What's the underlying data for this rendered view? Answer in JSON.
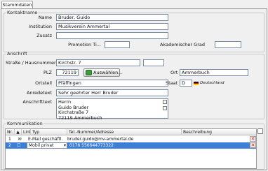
{
  "tab": "Stammdaten",
  "kontakt": {
    "legend": "Kontaktname",
    "name_label": "Name",
    "name_value": "Bruder, Guido",
    "institution_label": "Institution",
    "institution_value": "Musikverein Ammertal",
    "zusatz_label": "Zusatz",
    "zusatz_value": "",
    "promotion_label": "Promotion Ti...",
    "promotion_value": "",
    "akad_label": "Akademischer Grad",
    "akad_value": ""
  },
  "anschrift": {
    "legend": "Anschrift",
    "strasse_label": "Straße / Hausnummer",
    "strasse_value": "Kirchstr. 7",
    "hausnr_value": "",
    "plz_label": "PLZ",
    "plz_value": "72119",
    "auswaehlen_label": "Auswählen...",
    "ort_label": "Ort",
    "ort_value": "Ammerbuch",
    "ortsteil_label": "Ortsteil",
    "ortsteil_value": "Pfäffingen",
    "staat_label": "Staat",
    "staat_value": "D",
    "staat_name": "Deutschland",
    "anrede_label": "Anredetext",
    "anrede_value": "Sehr geehrter Herr Bruder",
    "anschrift_label": "Anschrifttext",
    "anschrift_lines": [
      "Herrn",
      "Guido Bruder",
      "Kirchstraße 7",
      "72119 Ammerbuch"
    ]
  },
  "kommunikation": {
    "legend": "Kommunikation",
    "columns": [
      "Nr.",
      "Link",
      "Typ",
      "Tel.-Nummer/Adresse",
      "Beschreibung"
    ],
    "rows": [
      {
        "nr": "1",
        "typ": "E-Mail geschäftl.",
        "adresse": "bruder.guido@mv-ammertal.de",
        "beschreibung": ""
      },
      {
        "nr": "2",
        "typ": "Mobil privat",
        "adresse": "0176 556644773322",
        "beschreibung": ""
      }
    ]
  },
  "colors": {
    "selection": "#3d7fd6",
    "button_icon": "#3e9a3e",
    "delete": "#c21f1f"
  }
}
